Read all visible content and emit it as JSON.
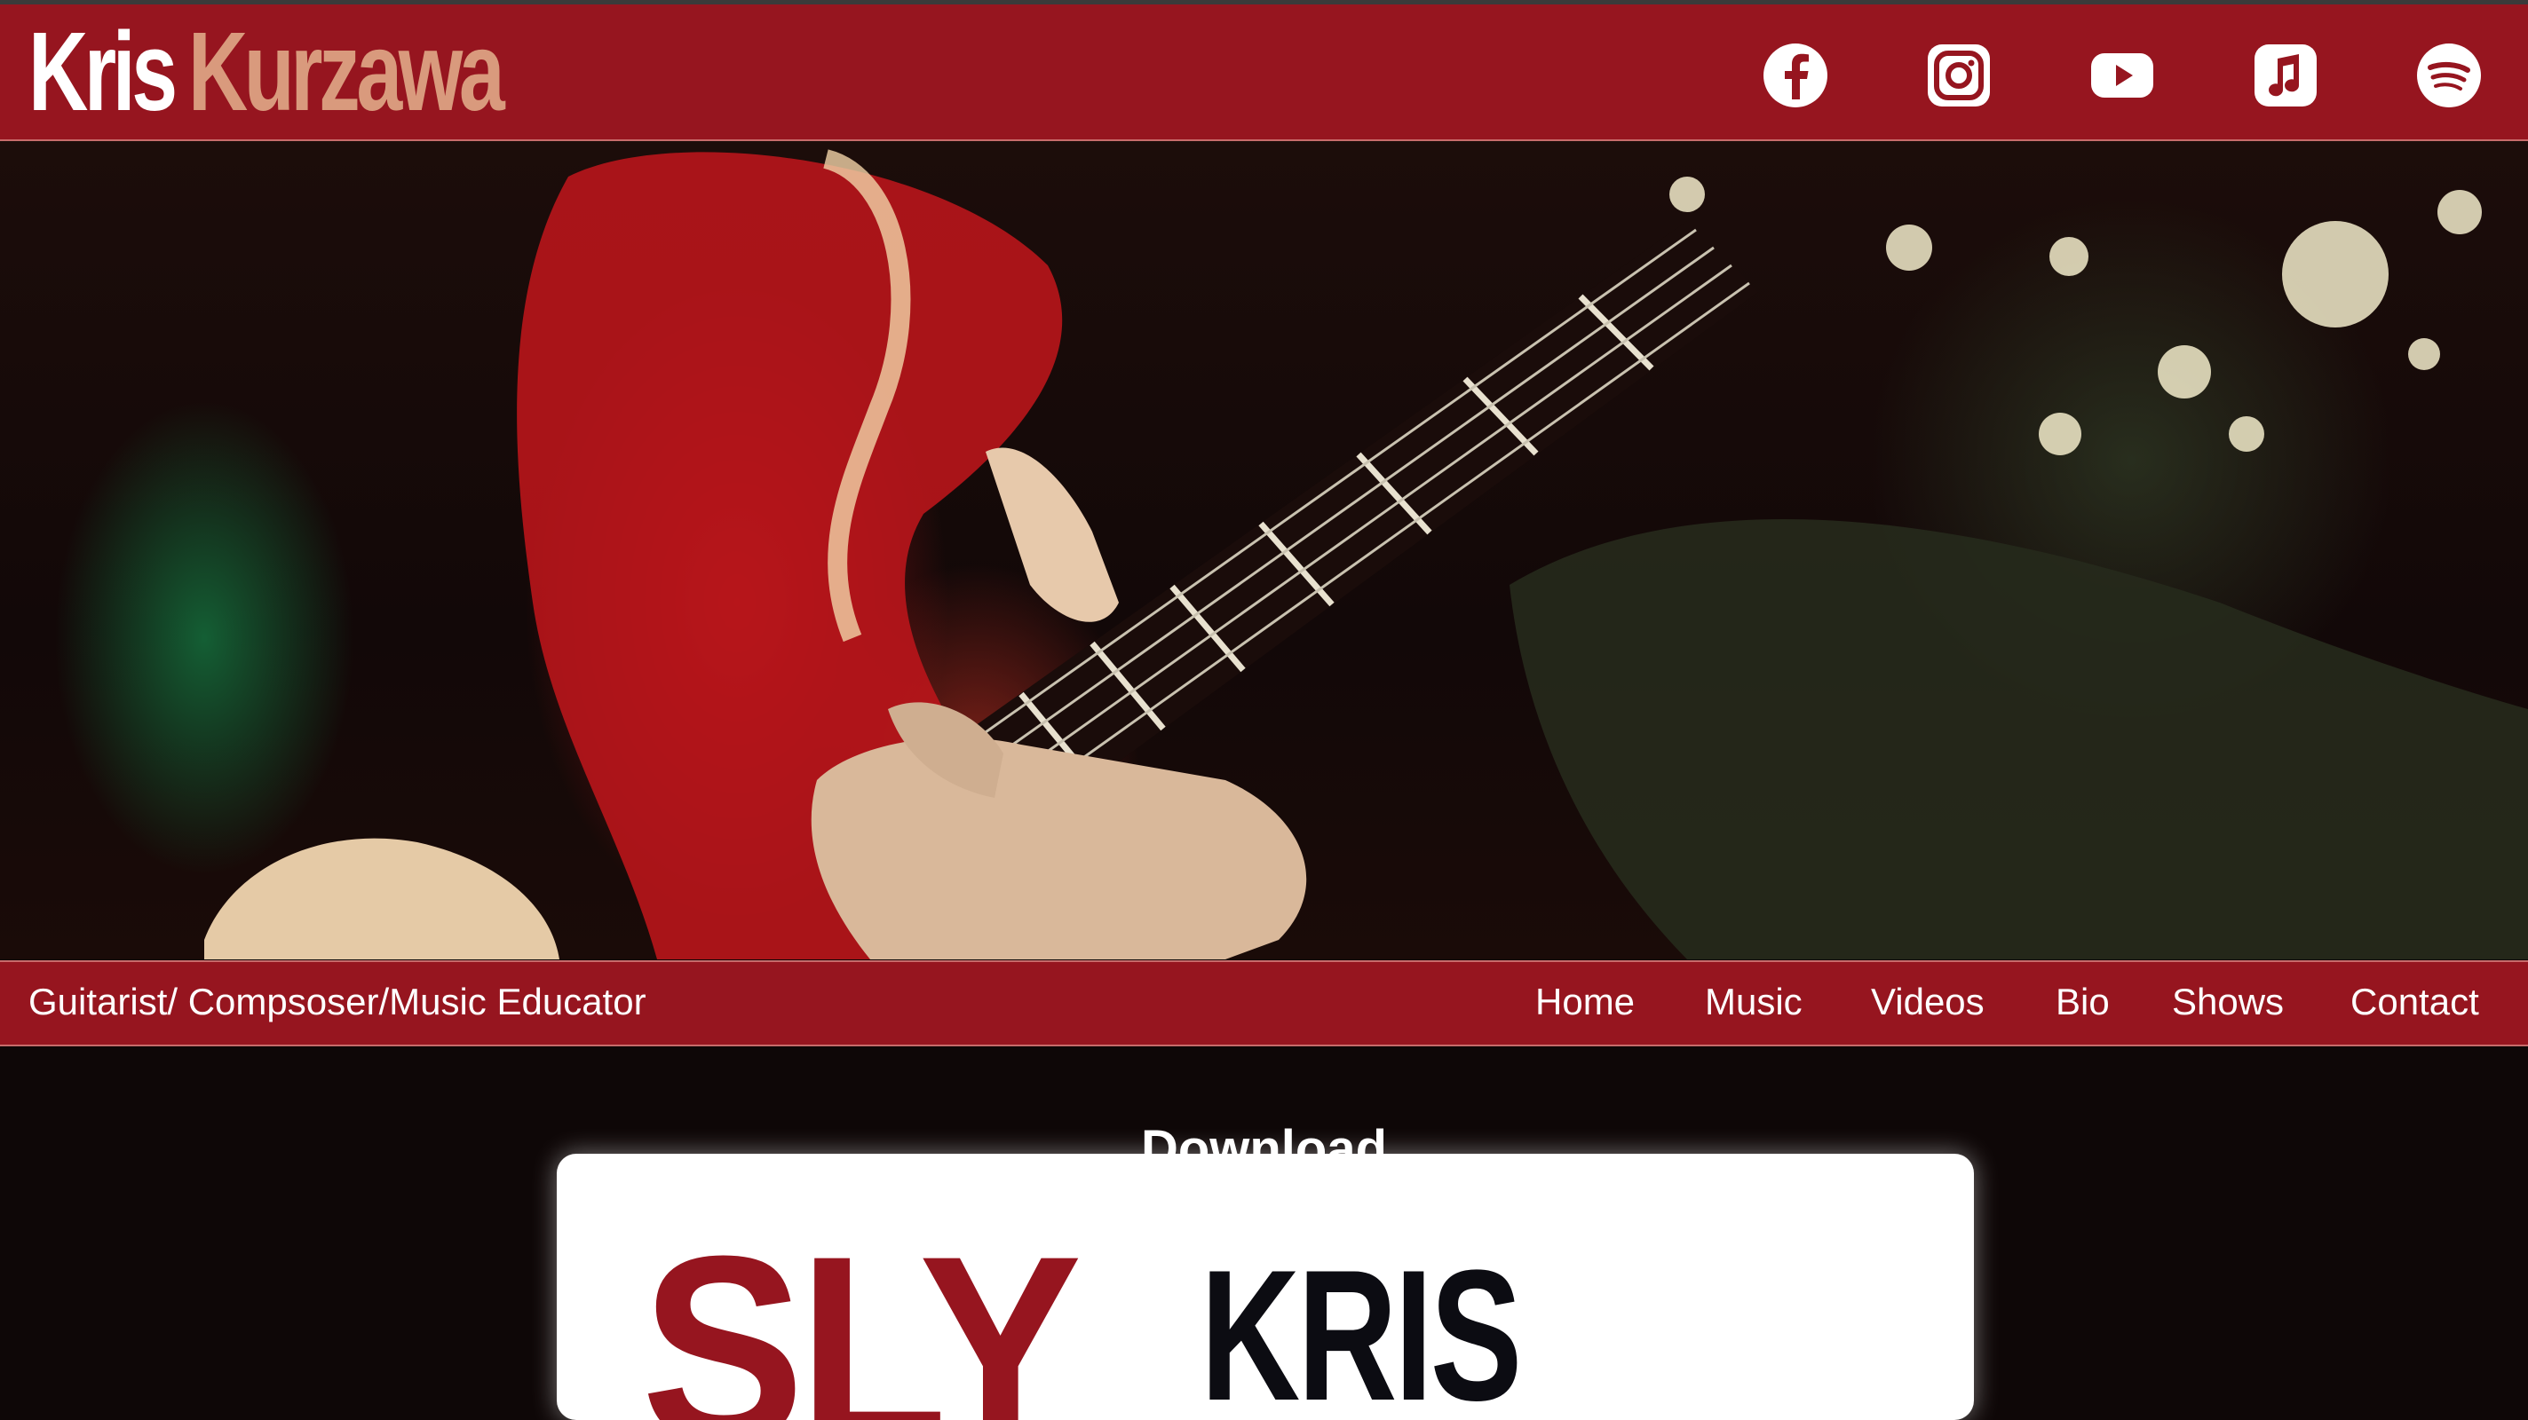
{
  "header": {
    "logo_first": "Kris",
    "logo_last": "Kurzawa",
    "social_links": [
      {
        "name": "facebook-icon"
      },
      {
        "name": "instagram-icon"
      },
      {
        "name": "youtube-icon"
      },
      {
        "name": "apple-music-icon"
      },
      {
        "name": "spotify-icon"
      }
    ]
  },
  "hero": {
    "image": "guitarist-closeup-photo"
  },
  "subnav": {
    "tagline": "Guitarist/ Compsoser/Music Educator",
    "items": [
      "Home",
      "Music",
      "Videos",
      "Bio",
      "Shows",
      "Contact"
    ]
  },
  "main": {
    "section_title": "Download",
    "card": {
      "word1": "SLY",
      "word2": "KRIS"
    }
  },
  "colors": {
    "brand_red": "#96151f",
    "logo_accent": "#d99a7d",
    "background": "#0e0707"
  }
}
